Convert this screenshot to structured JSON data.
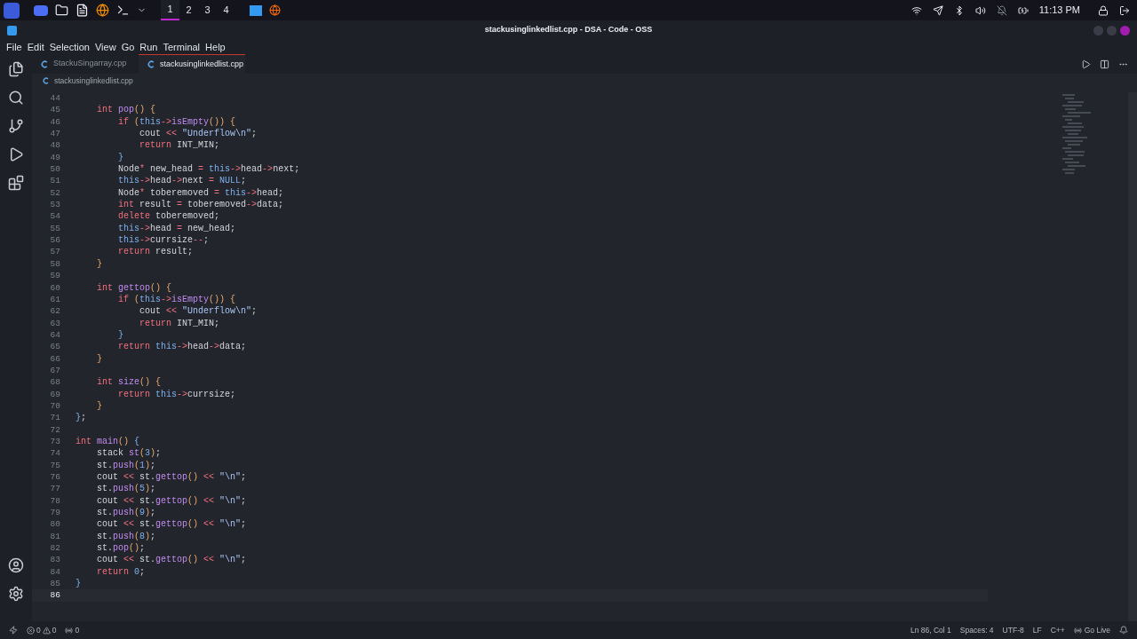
{
  "taskbar": {
    "workspaces": [
      {
        "label": "1",
        "selected": true
      },
      {
        "label": "2",
        "selected": false
      },
      {
        "label": "3",
        "selected": false
      },
      {
        "label": "4",
        "selected": false
      }
    ],
    "clock": "11:13 PM"
  },
  "window": {
    "title": "stackusinglinkedlist.cpp - DSA - Code - OSS"
  },
  "menu": [
    "File",
    "Edit",
    "Selection",
    "View",
    "Go",
    "Run",
    "Terminal",
    "Help"
  ],
  "tabs": [
    {
      "label": "StackuSingarray.cpp",
      "selected": false
    },
    {
      "label": "stackusinglinkedlist.cpp",
      "selected": true
    }
  ],
  "breadcrumb": "stackusinglinkedlist.cpp",
  "editor": {
    "lines": [
      {
        "number": "44",
        "selected": false
      },
      {
        "number": "45",
        "selected": false,
        "tokens": [
          {
            "kind": "keyword",
            "text": "    int "
          },
          {
            "kind": "function",
            "text": "pop"
          },
          {
            "kind": "bracket",
            "text": "() {"
          }
        ]
      },
      {
        "number": "46",
        "selected": false,
        "tokens": [
          {
            "kind": "keyword",
            "text": "        if "
          },
          {
            "kind": "bracket",
            "text": "("
          },
          {
            "kind": "this",
            "text": "this"
          },
          {
            "kind": "operator",
            "text": "->"
          },
          {
            "kind": "function",
            "text": "isEmpty"
          },
          {
            "kind": "bracket",
            "text": "()) {"
          }
        ]
      },
      {
        "number": "47",
        "selected": false,
        "tokens": [
          {
            "kind": "plain",
            "text": "            cout "
          },
          {
            "kind": "operator",
            "text": "<< "
          },
          {
            "kind": "string",
            "text": "\"Underflow\\n\""
          },
          {
            "kind": "plain",
            "text": ";"
          }
        ]
      },
      {
        "number": "48",
        "selected": false,
        "tokens": [
          {
            "kind": "keyword",
            "text": "            return"
          },
          {
            "kind": "plain",
            "text": " INT_MIN;"
          }
        ]
      },
      {
        "number": "49",
        "selected": false,
        "tokens": [
          {
            "kind": "this",
            "text": "        }"
          }
        ]
      },
      {
        "number": "50",
        "selected": false,
        "tokens": [
          {
            "kind": "plain",
            "text": "        Node"
          },
          {
            "kind": "operator",
            "text": "*"
          },
          {
            "kind": "plain",
            "text": " new_head "
          },
          {
            "kind": "operator",
            "text": "= "
          },
          {
            "kind": "this",
            "text": "this"
          },
          {
            "kind": "operator",
            "text": "->"
          },
          {
            "kind": "plain",
            "text": "head"
          },
          {
            "kind": "operator",
            "text": "->"
          },
          {
            "kind": "plain",
            "text": "next;"
          }
        ]
      },
      {
        "number": "51",
        "selected": false,
        "tokens": [
          {
            "kind": "this",
            "text": "        this"
          },
          {
            "kind": "operator",
            "text": "->"
          },
          {
            "kind": "plain",
            "text": "head"
          },
          {
            "kind": "operator",
            "text": "->"
          },
          {
            "kind": "plain",
            "text": "next "
          },
          {
            "kind": "operator",
            "text": "= "
          },
          {
            "kind": "this",
            "text": "NULL"
          },
          {
            "kind": "plain",
            "text": ";"
          }
        ]
      },
      {
        "number": "52",
        "selected": false,
        "tokens": [
          {
            "kind": "plain",
            "text": "        Node"
          },
          {
            "kind": "operator",
            "text": "*"
          },
          {
            "kind": "plain",
            "text": " toberemoved "
          },
          {
            "kind": "operator",
            "text": "= "
          },
          {
            "kind": "this",
            "text": "this"
          },
          {
            "kind": "operator",
            "text": "->"
          },
          {
            "kind": "plain",
            "text": "head;"
          }
        ]
      },
      {
        "number": "53",
        "selected": false,
        "tokens": [
          {
            "kind": "keyword",
            "text": "        int"
          },
          {
            "kind": "plain",
            "text": " result "
          },
          {
            "kind": "operator",
            "text": "="
          },
          {
            "kind": "plain",
            "text": " toberemoved"
          },
          {
            "kind": "operator",
            "text": "->"
          },
          {
            "kind": "plain",
            "text": "data;"
          }
        ]
      },
      {
        "number": "54",
        "selected": false,
        "tokens": [
          {
            "kind": "keyword",
            "text": "        delete"
          },
          {
            "kind": "plain",
            "text": " toberemoved;"
          }
        ]
      },
      {
        "number": "55",
        "selected": false,
        "tokens": [
          {
            "kind": "this",
            "text": "        this"
          },
          {
            "kind": "operator",
            "text": "->"
          },
          {
            "kind": "plain",
            "text": "head "
          },
          {
            "kind": "operator",
            "text": "="
          },
          {
            "kind": "plain",
            "text": " new_head;"
          }
        ]
      },
      {
        "number": "56",
        "selected": false,
        "tokens": [
          {
            "kind": "this",
            "text": "        this"
          },
          {
            "kind": "operator",
            "text": "->"
          },
          {
            "kind": "plain",
            "text": "currsize"
          },
          {
            "kind": "operator",
            "text": "--"
          },
          {
            "kind": "plain",
            "text": ";"
          }
        ]
      },
      {
        "number": "57",
        "selected": false,
        "tokens": [
          {
            "kind": "keyword",
            "text": "        return"
          },
          {
            "kind": "plain",
            "text": " result;"
          }
        ]
      },
      {
        "number": "58",
        "selected": false,
        "tokens": [
          {
            "kind": "bracket",
            "text": "    }"
          }
        ]
      },
      {
        "number": "59",
        "selected": false
      },
      {
        "number": "60",
        "selected": false,
        "tokens": [
          {
            "kind": "keyword",
            "text": "    int "
          },
          {
            "kind": "function",
            "text": "gettop"
          },
          {
            "kind": "bracket",
            "text": "() {"
          }
        ]
      },
      {
        "number": "61",
        "selected": false,
        "tokens": [
          {
            "kind": "keyword",
            "text": "        if "
          },
          {
            "kind": "bracket",
            "text": "("
          },
          {
            "kind": "this",
            "text": "this"
          },
          {
            "kind": "operator",
            "text": "->"
          },
          {
            "kind": "function",
            "text": "isEmpty"
          },
          {
            "kind": "bracket",
            "text": "()) {"
          }
        ]
      },
      {
        "number": "62",
        "selected": false,
        "tokens": [
          {
            "kind": "plain",
            "text": "            cout "
          },
          {
            "kind": "operator",
            "text": "<< "
          },
          {
            "kind": "string",
            "text": "\"Underflow\\n\""
          },
          {
            "kind": "plain",
            "text": ";"
          }
        ]
      },
      {
        "number": "63",
        "selected": false,
        "tokens": [
          {
            "kind": "keyword",
            "text": "            return"
          },
          {
            "kind": "plain",
            "text": " INT_MIN;"
          }
        ]
      },
      {
        "number": "64",
        "selected": false,
        "tokens": [
          {
            "kind": "this",
            "text": "        }"
          }
        ]
      },
      {
        "number": "65",
        "selected": false,
        "tokens": [
          {
            "kind": "keyword",
            "text": "        return "
          },
          {
            "kind": "this",
            "text": "this"
          },
          {
            "kind": "operator",
            "text": "->"
          },
          {
            "kind": "plain",
            "text": "head"
          },
          {
            "kind": "operator",
            "text": "->"
          },
          {
            "kind": "plain",
            "text": "data;"
          }
        ]
      },
      {
        "number": "66",
        "selected": false,
        "tokens": [
          {
            "kind": "bracket",
            "text": "    }"
          }
        ]
      },
      {
        "number": "67",
        "selected": false
      },
      {
        "number": "68",
        "selected": false,
        "tokens": [
          {
            "kind": "keyword",
            "text": "    int "
          },
          {
            "kind": "function",
            "text": "size"
          },
          {
            "kind": "bracket",
            "text": "() {"
          }
        ]
      },
      {
        "number": "69",
        "selected": false,
        "tokens": [
          {
            "kind": "keyword",
            "text": "        return "
          },
          {
            "kind": "this",
            "text": "this"
          },
          {
            "kind": "operator",
            "text": "->"
          },
          {
            "kind": "plain",
            "text": "currsize;"
          }
        ]
      },
      {
        "number": "70",
        "selected": false,
        "tokens": [
          {
            "kind": "bracket",
            "text": "    }"
          }
        ]
      },
      {
        "number": "71",
        "selected": false,
        "tokens": [
          {
            "kind": "this",
            "text": "}"
          },
          {
            "kind": "plain",
            "text": ";"
          }
        ]
      },
      {
        "number": "72",
        "selected": false
      },
      {
        "number": "73",
        "selected": false,
        "tokens": [
          {
            "kind": "keyword",
            "text": "int "
          },
          {
            "kind": "function",
            "text": "main"
          },
          {
            "kind": "bracket",
            "text": "() "
          },
          {
            "kind": "this",
            "text": "{"
          }
        ]
      },
      {
        "number": "74",
        "selected": false,
        "tokens": [
          {
            "kind": "plain",
            "text": "    stack "
          },
          {
            "kind": "function",
            "text": "st"
          },
          {
            "kind": "bracket",
            "text": "("
          },
          {
            "kind": "number",
            "text": "3"
          },
          {
            "kind": "bracket",
            "text": ")"
          },
          {
            "kind": "plain",
            "text": ";"
          }
        ]
      },
      {
        "number": "75",
        "selected": false,
        "tokens": [
          {
            "kind": "plain",
            "text": "    st."
          },
          {
            "kind": "function",
            "text": "push"
          },
          {
            "kind": "bracket",
            "text": "("
          },
          {
            "kind": "number",
            "text": "1"
          },
          {
            "kind": "bracket",
            "text": ")"
          },
          {
            "kind": "plain",
            "text": ";"
          }
        ]
      },
      {
        "number": "76",
        "selected": false,
        "tokens": [
          {
            "kind": "plain",
            "text": "    cout "
          },
          {
            "kind": "operator",
            "text": "<<"
          },
          {
            "kind": "plain",
            "text": " st."
          },
          {
            "kind": "function",
            "text": "gettop"
          },
          {
            "kind": "bracket",
            "text": "() "
          },
          {
            "kind": "operator",
            "text": "<< "
          },
          {
            "kind": "string",
            "text": "\"\\n\""
          },
          {
            "kind": "plain",
            "text": ";"
          }
        ]
      },
      {
        "number": "77",
        "selected": false,
        "tokens": [
          {
            "kind": "plain",
            "text": "    st."
          },
          {
            "kind": "function",
            "text": "push"
          },
          {
            "kind": "bracket",
            "text": "("
          },
          {
            "kind": "number",
            "text": "5"
          },
          {
            "kind": "bracket",
            "text": ")"
          },
          {
            "kind": "plain",
            "text": ";"
          }
        ]
      },
      {
        "number": "78",
        "selected": false,
        "tokens": [
          {
            "kind": "plain",
            "text": "    cout "
          },
          {
            "kind": "operator",
            "text": "<<"
          },
          {
            "kind": "plain",
            "text": " st."
          },
          {
            "kind": "function",
            "text": "gettop"
          },
          {
            "kind": "bracket",
            "text": "() "
          },
          {
            "kind": "operator",
            "text": "<< "
          },
          {
            "kind": "string",
            "text": "\"\\n\""
          },
          {
            "kind": "plain",
            "text": ";"
          }
        ]
      },
      {
        "number": "79",
        "selected": false,
        "tokens": [
          {
            "kind": "plain",
            "text": "    st."
          },
          {
            "kind": "function",
            "text": "push"
          },
          {
            "kind": "bracket",
            "text": "("
          },
          {
            "kind": "number",
            "text": "9"
          },
          {
            "kind": "bracket",
            "text": ")"
          },
          {
            "kind": "plain",
            "text": ";"
          }
        ]
      },
      {
        "number": "80",
        "selected": false,
        "tokens": [
          {
            "kind": "plain",
            "text": "    cout "
          },
          {
            "kind": "operator",
            "text": "<<"
          },
          {
            "kind": "plain",
            "text": " st."
          },
          {
            "kind": "function",
            "text": "gettop"
          },
          {
            "kind": "bracket",
            "text": "() "
          },
          {
            "kind": "operator",
            "text": "<< "
          },
          {
            "kind": "string",
            "text": "\"\\n\""
          },
          {
            "kind": "plain",
            "text": ";"
          }
        ]
      },
      {
        "number": "81",
        "selected": false,
        "tokens": [
          {
            "kind": "plain",
            "text": "    st."
          },
          {
            "kind": "function",
            "text": "push"
          },
          {
            "kind": "bracket",
            "text": "("
          },
          {
            "kind": "number",
            "text": "8"
          },
          {
            "kind": "bracket",
            "text": ")"
          },
          {
            "kind": "plain",
            "text": ";"
          }
        ]
      },
      {
        "number": "82",
        "selected": false,
        "tokens": [
          {
            "kind": "plain",
            "text": "    st."
          },
          {
            "kind": "function",
            "text": "pop"
          },
          {
            "kind": "bracket",
            "text": "()"
          },
          {
            "kind": "plain",
            "text": ";"
          }
        ]
      },
      {
        "number": "83",
        "selected": false,
        "tokens": [
          {
            "kind": "plain",
            "text": "    cout "
          },
          {
            "kind": "operator",
            "text": "<<"
          },
          {
            "kind": "plain",
            "text": " st."
          },
          {
            "kind": "function",
            "text": "gettop"
          },
          {
            "kind": "bracket",
            "text": "() "
          },
          {
            "kind": "operator",
            "text": "<< "
          },
          {
            "kind": "string",
            "text": "\"\\n\""
          },
          {
            "kind": "plain",
            "text": ";"
          }
        ]
      },
      {
        "number": "84",
        "selected": false,
        "tokens": [
          {
            "kind": "keyword",
            "text": "    return "
          },
          {
            "kind": "number",
            "text": "0"
          },
          {
            "kind": "plain",
            "text": ";"
          }
        ]
      },
      {
        "number": "85",
        "selected": false,
        "tokens": [
          {
            "kind": "this",
            "text": "}"
          }
        ]
      },
      {
        "number": "86",
        "selected": true
      }
    ]
  },
  "status_bar": {
    "errors": "0",
    "warnings": "0",
    "ports": "0",
    "position": "Ln 86, Col 1",
    "spaces": "Spaces: 4",
    "encoding": "UTF-8",
    "eol": "LF",
    "language": "C++",
    "live": "Go Live"
  }
}
